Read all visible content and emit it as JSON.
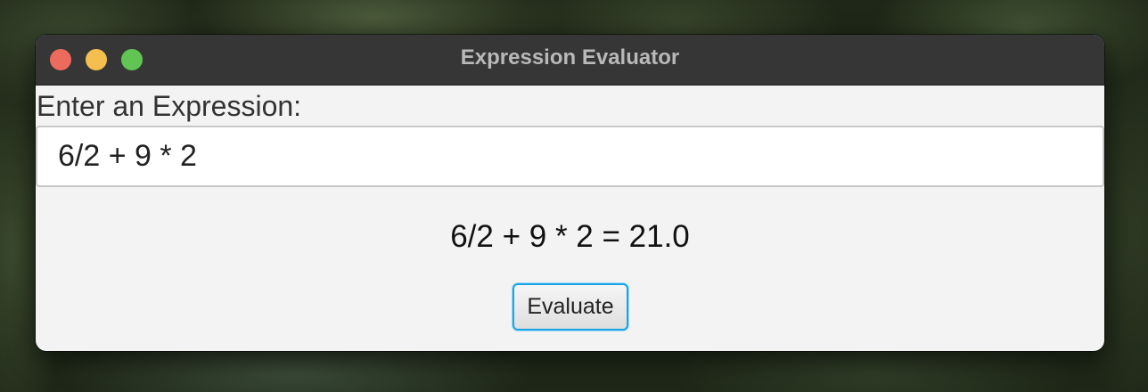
{
  "window": {
    "title": "Expression Evaluator"
  },
  "form": {
    "prompt_label": "Enter an Expression:",
    "expression_value": "6/2 + 9 * 2",
    "result_text": "6/2 + 9 * 2 = 21.0",
    "evaluate_label": "Evaluate"
  },
  "colors": {
    "titlebar": "#363636",
    "close": "#ed6a5e",
    "minimize": "#f5bf4f",
    "maximize": "#61c554",
    "focus_ring": "#1aa4e6"
  }
}
